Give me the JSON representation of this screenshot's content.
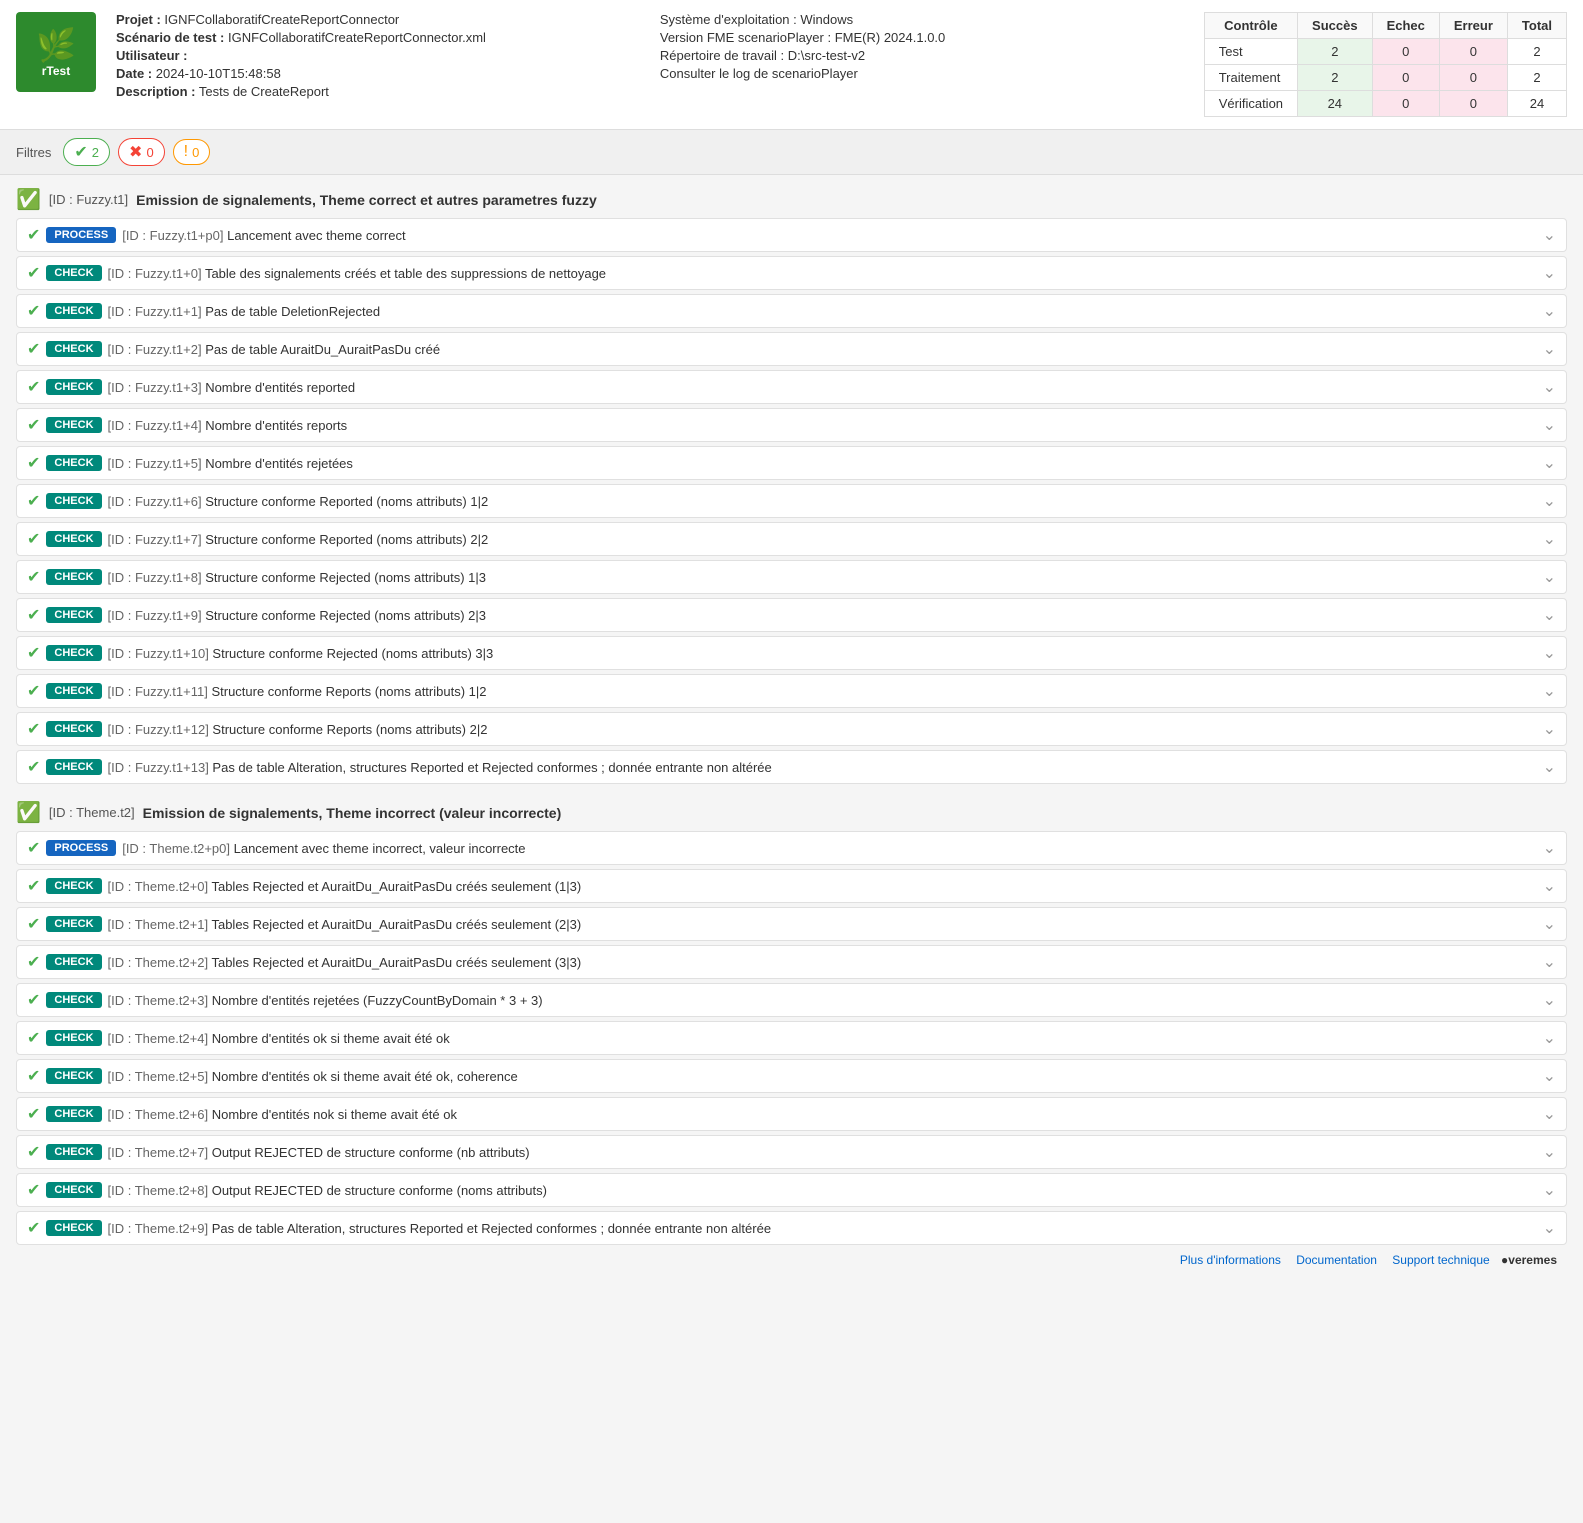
{
  "header": {
    "logo_text": "rTest",
    "logo_icon": "🌿",
    "project_label": "Projet :",
    "project_value": "IGNFCollaboratifCreateReportConnector",
    "scenario_label": "Scénario de test :",
    "scenario_value": "IGNFCollaboratifCreateReportConnector.xml",
    "user_label": "Utilisateur :",
    "user_value": "",
    "date_label": "Date :",
    "date_value": "2024-10-10T15:48:58",
    "description_label": "Description :",
    "description_value": "Tests de CreateReport",
    "os_label": "Système d'exploitation :",
    "os_value": "Windows",
    "version_label": "Version FME scenarioPlayer :",
    "version_value": "FME(R) 2024.1.0.0",
    "workdir_label": "Répertoire de travail :",
    "workdir_value": "D:\\src-test-v2",
    "log_link": "Consulter le log de scenarioPlayer"
  },
  "stats": {
    "headers": [
      "Contrôle",
      "Succès",
      "Echec",
      "Erreur",
      "Total"
    ],
    "rows": [
      {
        "label": "Test",
        "success": "2",
        "echec": "0",
        "erreur": "0",
        "total": "2"
      },
      {
        "label": "Traitement",
        "success": "2",
        "echec": "0",
        "erreur": "0",
        "total": "2"
      },
      {
        "label": "Vérification",
        "success": "24",
        "echec": "0",
        "erreur": "0",
        "total": "24"
      }
    ]
  },
  "filters": {
    "label": "Filtres",
    "badges": [
      {
        "count": "2",
        "type": "green"
      },
      {
        "count": "0",
        "type": "red"
      },
      {
        "count": "0",
        "type": "orange"
      }
    ]
  },
  "groups": [
    {
      "id": "[ID : Fuzzy.t1]",
      "title": "Emission de signalements, Theme correct et autres parametres fuzzy",
      "items": [
        {
          "type": "PROCESS",
          "id": "[ID : Fuzzy.t1+p0]",
          "text": "Lancement avec theme correct"
        },
        {
          "type": "CHECK",
          "id": "[ID : Fuzzy.t1+0]",
          "text": "Table des signalements créés et table des suppressions de nettoyage"
        },
        {
          "type": "CHECK",
          "id": "[ID : Fuzzy.t1+1]",
          "text": "Pas de table DeletionRejected"
        },
        {
          "type": "CHECK",
          "id": "[ID : Fuzzy.t1+2]",
          "text": "Pas de table AuraitDu_AuraitPasDu créé"
        },
        {
          "type": "CHECK",
          "id": "[ID : Fuzzy.t1+3]",
          "text": "Nombre d'entités reported"
        },
        {
          "type": "CHECK",
          "id": "[ID : Fuzzy.t1+4]",
          "text": "Nombre d'entités reports"
        },
        {
          "type": "CHECK",
          "id": "[ID : Fuzzy.t1+5]",
          "text": "Nombre d'entités rejetées"
        },
        {
          "type": "CHECK",
          "id": "[ID : Fuzzy.t1+6]",
          "text": "Structure conforme Reported (noms attributs) 1|2"
        },
        {
          "type": "CHECK",
          "id": "[ID : Fuzzy.t1+7]",
          "text": "Structure conforme Reported (noms attributs) 2|2"
        },
        {
          "type": "CHECK",
          "id": "[ID : Fuzzy.t1+8]",
          "text": "Structure conforme Rejected (noms attributs) 1|3"
        },
        {
          "type": "CHECK",
          "id": "[ID : Fuzzy.t1+9]",
          "text": "Structure conforme Rejected (noms attributs) 2|3"
        },
        {
          "type": "CHECK",
          "id": "[ID : Fuzzy.t1+10]",
          "text": "Structure conforme Rejected (noms attributs) 3|3"
        },
        {
          "type": "CHECK",
          "id": "[ID : Fuzzy.t1+11]",
          "text": "Structure conforme Reports (noms attributs) 1|2"
        },
        {
          "type": "CHECK",
          "id": "[ID : Fuzzy.t1+12]",
          "text": "Structure conforme Reports (noms attributs) 2|2"
        },
        {
          "type": "CHECK",
          "id": "[ID : Fuzzy.t1+13]",
          "text": "Pas de table Alteration, structures Reported et Rejected conformes ; donnée entrante non altérée"
        }
      ]
    },
    {
      "id": "[ID : Theme.t2]",
      "title": "Emission de signalements, Theme incorrect (valeur incorrecte)",
      "items": [
        {
          "type": "PROCESS",
          "id": "[ID : Theme.t2+p0]",
          "text": "Lancement avec theme incorrect, valeur incorrecte"
        },
        {
          "type": "CHECK",
          "id": "[ID : Theme.t2+0]",
          "text": "Tables Rejected et AuraitDu_AuraitPasDu créés seulement (1|3)"
        },
        {
          "type": "CHECK",
          "id": "[ID : Theme.t2+1]",
          "text": "Tables Rejected et AuraitDu_AuraitPasDu créés seulement (2|3)"
        },
        {
          "type": "CHECK",
          "id": "[ID : Theme.t2+2]",
          "text": "Tables Rejected et AuraitDu_AuraitPasDu créés seulement (3|3)"
        },
        {
          "type": "CHECK",
          "id": "[ID : Theme.t2+3]",
          "text": "Nombre d'entités rejetées (FuzzyCountByDomain * 3 + 3)"
        },
        {
          "type": "CHECK",
          "id": "[ID : Theme.t2+4]",
          "text": "Nombre d'entités ok si theme avait été ok"
        },
        {
          "type": "CHECK",
          "id": "[ID : Theme.t2+5]",
          "text": "Nombre d'entités ok si theme avait été ok, coherence"
        },
        {
          "type": "CHECK",
          "id": "[ID : Theme.t2+6]",
          "text": "Nombre d'entités nok si theme avait été ok"
        },
        {
          "type": "CHECK",
          "id": "[ID : Theme.t2+7]",
          "text": "Output REJECTED de structure conforme (nb attributs)"
        },
        {
          "type": "CHECK",
          "id": "[ID : Theme.t2+8]",
          "text": "Output REJECTED de structure conforme (noms attributs)"
        },
        {
          "type": "CHECK",
          "id": "[ID : Theme.t2+9]",
          "text": "Pas de table Alteration, structures Reported et Rejected conformes ; donnée entrante non altérée"
        }
      ]
    }
  ],
  "footer": {
    "more_info": "Plus d'informations",
    "documentation": "Documentation",
    "support": "Support technique",
    "brand": "●veremes"
  }
}
